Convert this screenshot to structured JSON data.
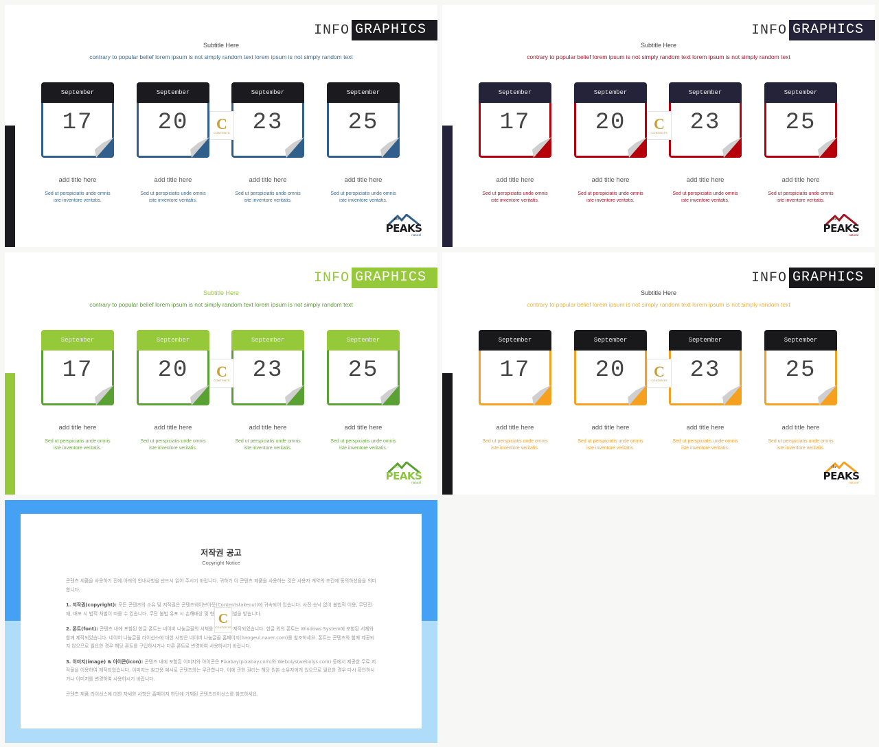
{
  "slides": [
    {
      "theme": "blue",
      "title_left": "INFO",
      "title_right": "GRAPHICS",
      "subtitle": "Subtitle Here",
      "description": "contrary to popular belief lorem ipsum is not simply random text lorem ipsum is not simply random text",
      "colors": {
        "head": "#1b1b1f",
        "accent": "#2f5f8a",
        "title_box": "#1b1b1f",
        "side_bar": "#1b1b1f",
        "subtitle": "#444444",
        "desc": "#3d6a8e",
        "item_text": "#3d6a8e",
        "info_text": "#333333",
        "logo_mountain": "#2f5f8a",
        "logo_word": "#1b1b1f"
      },
      "calendars": [
        {
          "month": "September",
          "day": "17"
        },
        {
          "month": "September",
          "day": "20"
        },
        {
          "month": "September",
          "day": "23"
        },
        {
          "month": "September",
          "day": "25"
        }
      ],
      "items": [
        {
          "title": "add title here",
          "line1": "Sed ut perspiciatis unde omnis",
          "line2": "iste inventore veritatis."
        },
        {
          "title": "add title here",
          "line1": "Sed ut perspiciatis unde omnis",
          "line2": "iste inventore veritatis."
        },
        {
          "title": "add title here",
          "line1": "Sed ut perspiciatis unde omnis",
          "line2": "iste inventore veritatis."
        },
        {
          "title": "add title here",
          "line1": "Sed ut perspiciatis unde omnis",
          "line2": "iste inventore veritatis."
        }
      ],
      "logo": {
        "the": "the",
        "word": "PEAKS",
        "sub": "natural"
      },
      "badge": {
        "letter": "C",
        "text": "CONTENTS"
      }
    },
    {
      "theme": "red",
      "title_left": "INFO",
      "title_right": "GRAPHICS",
      "subtitle": "Subtitle Here",
      "description": "contrary to popular belief lorem ipsum is not simply random text lorem ipsum is not simply random text",
      "colors": {
        "head": "#25233a",
        "accent": "#b5000b",
        "title_box": "#25233a",
        "side_bar": "#25233a",
        "subtitle": "#444444",
        "desc": "#a0182a",
        "item_text": "#a0182a",
        "info_text": "#333333",
        "logo_mountain": "#a01822",
        "logo_word": "#1b1b1f"
      },
      "calendars": [
        {
          "month": "September",
          "day": "17"
        },
        {
          "month": "September",
          "day": "20"
        },
        {
          "month": "September",
          "day": "23"
        },
        {
          "month": "September",
          "day": "25"
        }
      ],
      "items": [
        {
          "title": "add title here",
          "line1": "Sed ut perspiciatis unde omnis",
          "line2": "iste inventore veritatis."
        },
        {
          "title": "add title here",
          "line1": "Sed ut perspiciatis unde omnis",
          "line2": "iste inventore veritatis."
        },
        {
          "title": "add title here",
          "line1": "Sed ut perspiciatis unde omnis",
          "line2": "iste inventore veritatis."
        },
        {
          "title": "add title here",
          "line1": "Sed ut perspiciatis unde omnis",
          "line2": "iste inventore veritatis."
        }
      ],
      "logo": {
        "the": "the",
        "word": "PEAKS",
        "sub": "natural"
      },
      "badge": {
        "letter": "C",
        "text": "CONTENTS"
      }
    },
    {
      "theme": "green",
      "title_left": "INFO",
      "title_right": "GRAPHICS",
      "subtitle": "Subtitle Here",
      "description": "contrary to popular belief lorem ipsum is not simply random text lorem ipsum is not simply random text",
      "colors": {
        "head": "#95c93a",
        "accent": "#5aa133",
        "title_box": "#95c93a",
        "side_bar": "#95c93a",
        "subtitle": "#95c93a",
        "desc": "#5a9b3a",
        "item_text": "#6aa640",
        "info_text": "#95c93a",
        "logo_mountain": "#5aa133",
        "logo_word": "#8cc63f"
      },
      "calendars": [
        {
          "month": "September",
          "day": "17"
        },
        {
          "month": "September",
          "day": "20"
        },
        {
          "month": "September",
          "day": "23"
        },
        {
          "month": "September",
          "day": "25"
        }
      ],
      "items": [
        {
          "title": "add title here",
          "line1": "Sed ut perspiciatis unde omnis",
          "line2": "iste inventore veritatis."
        },
        {
          "title": "add title here",
          "line1": "Sed ut perspiciatis unde omnis",
          "line2": "iste inventore veritatis."
        },
        {
          "title": "add title here",
          "line1": "Sed ut perspiciatis unde omnis",
          "line2": "iste inventore veritatis."
        },
        {
          "title": "add title here",
          "line1": "Sed ut perspiciatis unde omnis",
          "line2": "iste inventore veritatis."
        }
      ],
      "logo": {
        "the": "the",
        "word": "PEAKS",
        "sub": "natural"
      },
      "badge": {
        "letter": "C",
        "text": "CONTENTS"
      }
    },
    {
      "theme": "orange",
      "title_left": "INFO",
      "title_right": "GRAPHICS",
      "subtitle": "Subtitle Here",
      "description": "contrary to popular belief lorem ipsum is not simply random text lorem ipsum is not simply random text",
      "colors": {
        "head": "#19191c",
        "accent": "#f5a01f",
        "title_box": "#19191c",
        "side_bar": "#19191c",
        "subtitle": "#444444",
        "desc": "#f0b040",
        "item_text": "#f0a030",
        "info_text": "#333333",
        "logo_mountain": "#f5a01f",
        "logo_word": "#1b1b1f"
      },
      "calendars": [
        {
          "month": "September",
          "day": "17"
        },
        {
          "month": "September",
          "day": "20"
        },
        {
          "month": "September",
          "day": "23"
        },
        {
          "month": "September",
          "day": "25"
        }
      ],
      "items": [
        {
          "title": "add title here",
          "line1": "Sed ut perspiciatis unde omnis",
          "line2": "iste inventore veritatis."
        },
        {
          "title": "add title here",
          "line1": "Sed ut perspiciatis unde omnis",
          "line2": "iste inventore veritatis."
        },
        {
          "title": "add title here",
          "line1": "Sed ut perspiciatis unde omnis",
          "line2": "iste inventore veritatis."
        },
        {
          "title": "add title here",
          "line1": "Sed ut perspiciatis unde omnis",
          "line2": "iste inventore veritatis."
        }
      ],
      "logo": {
        "the": "the",
        "word": "PEAKS",
        "sub": "natural"
      },
      "badge": {
        "letter": "C",
        "text": "CONTENTS"
      }
    }
  ],
  "copyright": {
    "title": "저작권 공고",
    "subtitle": "Copyright Notice",
    "intro": "콘텐츠 세품을 사용하기 전에 아래의 안내사항을 반드시 읽어 주시기 바랍니다. 귀하가 이 콘텐츠 제품을 사용하는 것은 사용자 계약의 조건에 동의하셨음을 의미합니다.",
    "sections": [
      {
        "label": "1. 저작권(copyright):",
        "text": "모든 콘텐츠의 소유 및 저작권은 콘텐츠웨이브아웃(Contentstakeout)에 귀속되어 있습니다. 사전 승낙 없이 불법적 이용, 무단전재, 배포 시 법적 처벌이 따를 수 있습니다. 무단 불법 유포 시 손해배상 및 형사상의 처벌을 받습니다."
      },
      {
        "label": "2. 폰트(font):",
        "text": "콘텐츠 내에 포함된 한글 폰트는 네이버 나눔글꼴의 서체를 이용하여 제작되었습니다. 한글 외의 폰트는 Windows System에 포함된 서체와 함께 제작되었습니다. 네이버 나눔글꼴 라이선스에 대한 사항은 네이버 나눔글꼴 홈페이지(hangeul.naver.com)를 참조하세요. 폰트는 콘텐츠와 함께 제공되지 않으므로 필요한 경우 해당 폰트를 구입하시거나 다른 폰트로 변경하여 사용하시기 바랍니다."
      },
      {
        "label": "3. 이미지(image) & 아이콘(icon):",
        "text": "콘텐츠 내에 포함된 이미지와 아이콘은 Pixabay(pixabay.com)와 Webolys(webolys.com) 등에서 제공한 무료 저작물을 이용하여 제작되었습니다. 이미지는 참고용 예시로 콘텐츠와는 무관합니다. 이에 관한 권리는 해당 원본 소유자에게 있으므로 필요한 경우 다시 확인하시거나 이미지를 변경하여 사용하시기 바랍니다."
      }
    ],
    "footer": "콘텐츠 제품 라이선스에 대한 자세한 사항은 홈페이지 하단에 기재된 콘텐츠라이선스를 참조하세요.",
    "colors": {
      "top": "#45a1f3",
      "bottom": "#aedcf9"
    },
    "badge": {
      "letter": "C",
      "text": "CONTENTS"
    }
  }
}
